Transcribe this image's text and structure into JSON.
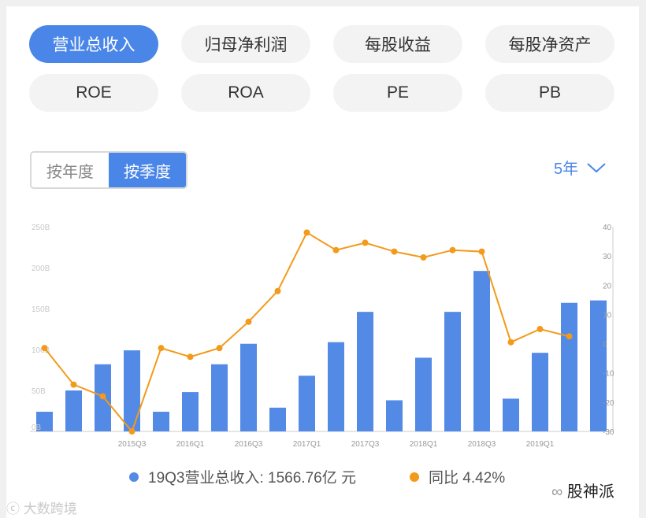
{
  "metrics": {
    "row1": [
      "营业总收入",
      "归母净利润",
      "每股收益",
      "每股净资产"
    ],
    "row2": [
      "ROE",
      "ROA",
      "PE",
      "PB"
    ],
    "active": "营业总收入"
  },
  "period": {
    "annual": "按年度",
    "quarterly": "按季度",
    "active": "quarterly"
  },
  "range": {
    "label": "5年"
  },
  "colors": {
    "accent": "#4a86e8",
    "bar": "#528ae6",
    "line": "#f39a1a",
    "button_bg": "#f3f3f3"
  },
  "chart_data": {
    "type": "bar",
    "categories": [
      "2014Q4",
      "2015Q1",
      "2015Q2",
      "2015Q3",
      "2015Q4",
      "2016Q1",
      "2016Q2",
      "2016Q3",
      "2016Q4",
      "2017Q1",
      "2017Q2",
      "2017Q3",
      "2017Q4",
      "2018Q1",
      "2018Q2",
      "2018Q3",
      "2018Q4",
      "2019Q1",
      "2019Q2",
      "2019Q3"
    ],
    "x_tick_labels": [
      "2015Q3",
      "2016Q1",
      "2016Q3",
      "2017Q1",
      "2017Q3",
      "2018Q1",
      "2018Q3",
      "2019Q1"
    ],
    "series": [
      {
        "name": "营业总收入",
        "kind": "bar",
        "axis": "left",
        "values": [
          24,
          50,
          82,
          99,
          24,
          48,
          82,
          107,
          29,
          68,
          109,
          146,
          38,
          90,
          146,
          196,
          40,
          96,
          157,
          160
        ]
      },
      {
        "name": "同比",
        "kind": "line",
        "axis": "right",
        "values": [
          -1.5,
          -14,
          -18,
          -30,
          -1.5,
          -4.5,
          -1.5,
          7.5,
          18,
          38,
          32,
          34.5,
          31.5,
          29.5,
          32,
          31.5,
          0.5,
          5,
          2.5
        ]
      }
    ],
    "y_left": {
      "ticks": [
        "0B",
        "50B",
        "100B",
        "150B",
        "200B",
        "250B"
      ],
      "ylim": [
        0,
        250
      ]
    },
    "y_right": {
      "ticks": [
        "-30",
        "-20",
        "-10",
        "0",
        "10",
        "20",
        "30",
        "40"
      ],
      "ylim": [
        -30,
        40
      ]
    },
    "legend": [
      {
        "label": "19Q3营业总收入: 1566.76亿 元",
        "color": "#528ae6"
      },
      {
        "label": "同比 4.42%",
        "color": "#f39a1a"
      }
    ]
  },
  "watermarks": {
    "left": "大数跨境",
    "right": "股神派"
  }
}
